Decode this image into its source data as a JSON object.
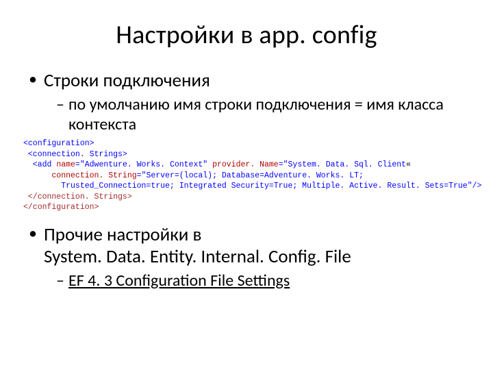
{
  "title": "Настройки в app. config",
  "bullets": {
    "b1": {
      "text": "Строки подключения",
      "sub": "по умолчанию имя строки подключения = имя класса контекста"
    },
    "b2": {
      "text_a": "Прочие настройки в",
      "text_b": "System. Data. Entity. Internal. Config. File",
      "sub": "EF 4. 3 Configuration File Settings"
    }
  },
  "code": {
    "l1": "<configuration>",
    "l2": " <connection. Strings>",
    "l3a": "  <add ",
    "l3b": "name",
    "l3c": "=\"",
    "l3d": "Adwenture. Works. Context",
    "l3e": "\" ",
    "l3f": "provider. Name",
    "l3g": "=\"",
    "l3h": "System. Data. Sql. Client",
    "l3i": "«",
    "l4a": "      connection. String",
    "l4b": "=\"",
    "l4c": "Server=(local); Database=Adventure. Works. LT;",
    "l5a": "        Trusted_Connection=true; Integrated Security=True; Multiple. Active. Result. Sets=True",
    "l5b": "\"/>",
    "l6": " </connection. Strings>",
    "l7": "</configuration>"
  }
}
